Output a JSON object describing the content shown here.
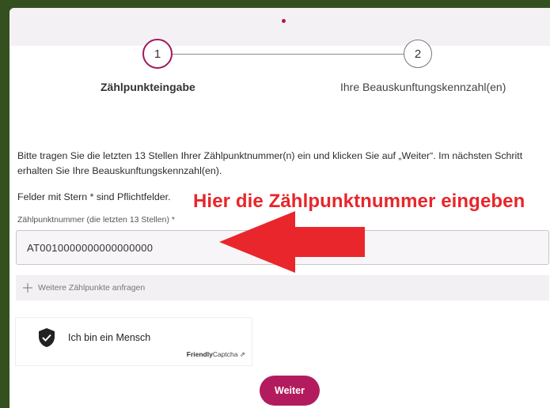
{
  "stepper": {
    "steps": [
      {
        "number": "1",
        "label": "Zählpunkteingabe"
      },
      {
        "number": "2",
        "label": "Ihre Beauskunftungskennzahl(en)"
      }
    ]
  },
  "form": {
    "intro": "Bitte tragen Sie die letzten 13 Stellen Ihrer Zählpunktnummer(n) ein und klicken Sie auf „Weiter“. Im nächsten Schritt erhalten Sie Ihre Beauskunftungskennzahl(en).",
    "required_note": "Felder mit Stern * sind Pflichtfelder.",
    "field_label": "Zählpunktnummer (die letzten 13 Stellen) *",
    "field_value": "AT0010000000000000000",
    "add_more_label": "Weitere Zählpunkte anfragen",
    "submit_label": "Weiter"
  },
  "annotation": {
    "text": "Hier die Zählpunktnummer eingeben",
    "color": "#e8262b"
  },
  "captcha": {
    "label": "Ich bin ein Mensch",
    "brand_bold": "Friendly",
    "brand_rest": "Captcha ⇗"
  },
  "colors": {
    "accent": "#b21c5e",
    "background": "#35501f"
  },
  "icons": {
    "add": "plus-icon",
    "captcha": "shield-check-icon",
    "annotation": "arrow-left-icon"
  }
}
